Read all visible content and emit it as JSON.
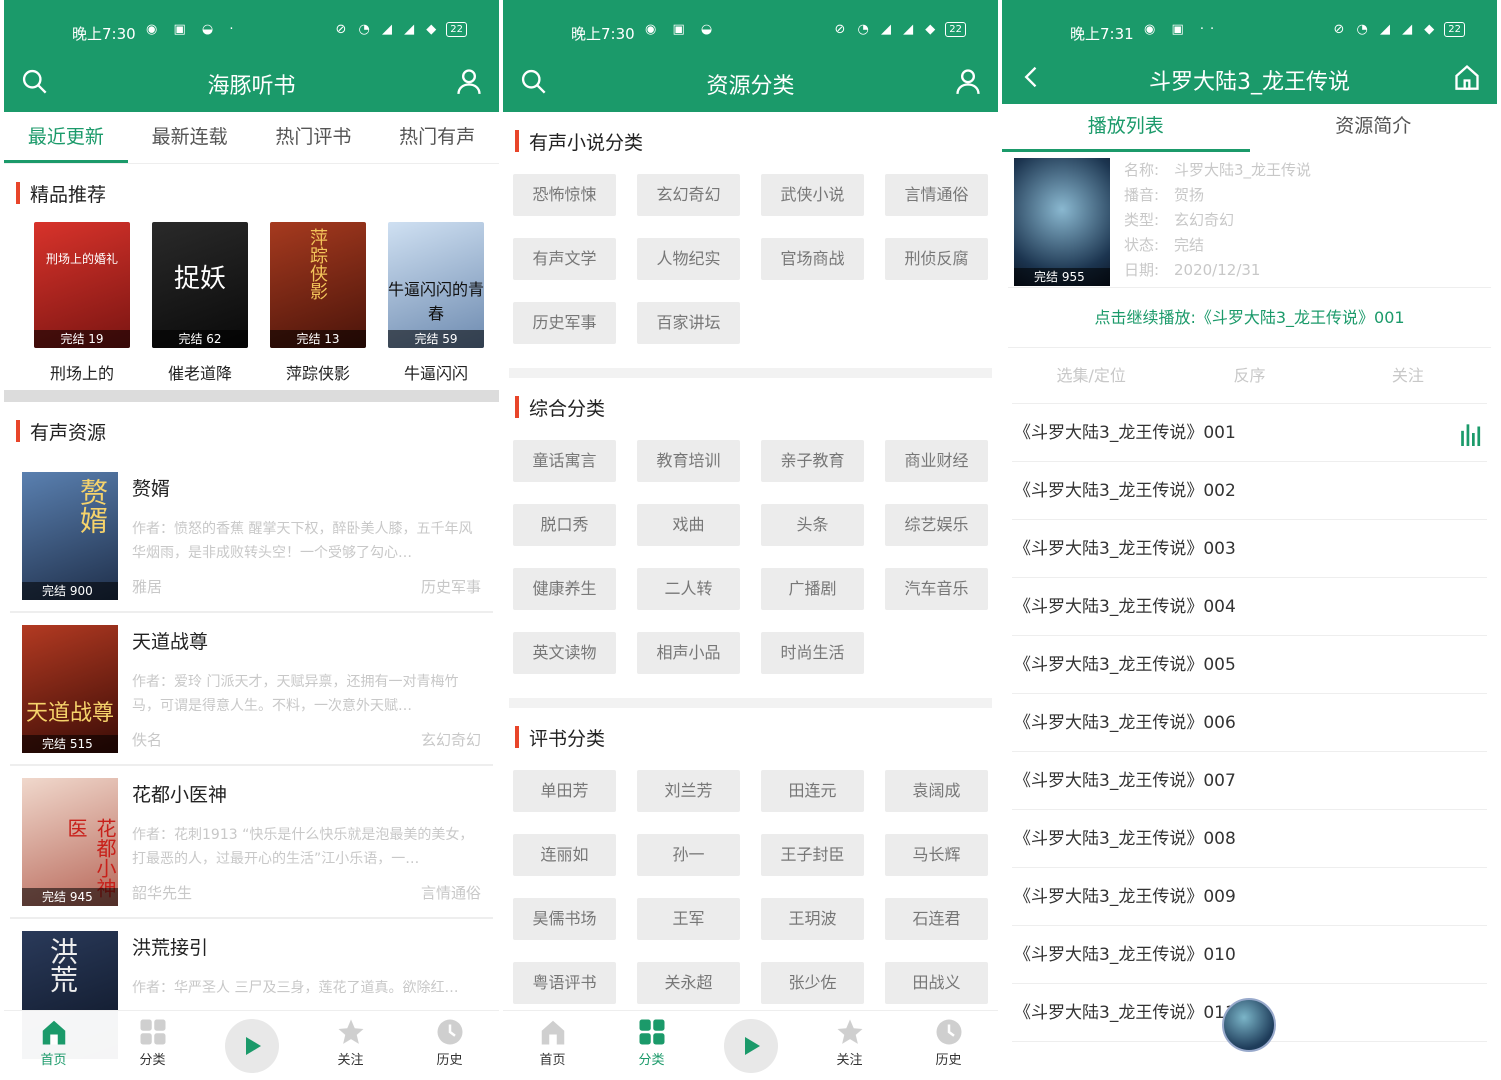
{
  "colors": {
    "brand": "#1b9a6a",
    "accent_bar": "#e8452a",
    "muted": "#c8c8c8"
  },
  "panel1": {
    "status": {
      "time": "晚上7:30",
      "battery": "22"
    },
    "title": "海豚听书",
    "tabs": [
      "最近更新",
      "最新连载",
      "热门评书",
      "热门有声"
    ],
    "rec_title": "精品推荐",
    "recommended": [
      {
        "name": "刑场上的",
        "badge": "完结 19",
        "cover_text": "刑场上的婚礼",
        "color": "#b3232a"
      },
      {
        "name": "催老道降",
        "badge": "完结 62",
        "cover_text": "捉妖",
        "color": "#1a1a1a"
      },
      {
        "name": "萍踪侠影",
        "badge": "完结 13",
        "cover_text": "萍踪侠影",
        "color": "#8a2a1a"
      },
      {
        "name": "牛逼闪闪",
        "badge": "完结 59",
        "cover_text": "牛逼闪闪的青春",
        "color": "#6e8bb0"
      }
    ],
    "res_title": "有声资源",
    "resources": [
      {
        "title": "赘婿",
        "desc": "作者：愤怒的香蕉 醒掌天下权，醉卧美人膝，五千年风华烟雨，是非成败转头空！一个受够了勾心…",
        "narrator": "雅居",
        "category": "历史军事",
        "badge": "完结 900",
        "cover_text": "赘婿",
        "color": "#3a5d8a"
      },
      {
        "title": "天道战尊",
        "desc": "作者：爱玲 门派天才，天赋异禀，还拥有一对青梅竹马，可谓是得意人生。不料，一次意外天赋…",
        "narrator": "佚名",
        "category": "玄幻奇幻",
        "badge": "完结 515",
        "cover_text": "天道战尊",
        "color": "#7a1a12"
      },
      {
        "title": "花都小医神",
        "desc": "作者：花刺1913 “快乐是什么快乐就是泡最美的美女，打最恶的人，过最开心的生活”江小乐语，一…",
        "narrator": "韶华先生",
        "category": "言情通俗",
        "badge": "完结 945",
        "cover_text": "花都小神医",
        "color": "#c77a6a"
      },
      {
        "title": "洪荒接引",
        "desc": "作者：华严圣人 三尸及三身，莲花了道真。欲除红…",
        "narrator": "",
        "category": "",
        "badge": "",
        "cover_text": "洪荒",
        "color": "#1a2a44"
      }
    ],
    "bottom_nav": [
      "首页",
      "分类",
      "",
      "关注",
      "历史"
    ]
  },
  "panel2": {
    "status": {
      "time": "晚上7:30",
      "battery": "22"
    },
    "title": "资源分类",
    "sections": [
      {
        "title": "有声小说分类",
        "items": [
          "恐怖惊悚",
          "玄幻奇幻",
          "武侠小说",
          "言情通俗",
          "有声文学",
          "人物纪实",
          "官场商战",
          "刑侦反腐",
          "历史军事",
          "百家讲坛"
        ]
      },
      {
        "title": "综合分类",
        "items": [
          "童话寓言",
          "教育培训",
          "亲子教育",
          "商业财经",
          "脱口秀",
          "戏曲",
          "头条",
          "综艺娱乐",
          "健康养生",
          "二人转",
          "广播剧",
          "汽车音乐",
          "英文读物",
          "相声小品",
          "时尚生活"
        ]
      },
      {
        "title": "评书分类",
        "items": [
          "单田芳",
          "刘兰芳",
          "田连元",
          "袁阔成",
          "连丽如",
          "孙一",
          "王子封臣",
          "马长辉",
          "昊儒书场",
          "王军",
          "王玥波",
          "石连君",
          "粤语评书",
          "关永超",
          "张少佐",
          "田战义"
        ]
      }
    ],
    "bottom_nav": [
      "首页",
      "分类",
      "",
      "关注",
      "历史"
    ]
  },
  "panel3": {
    "status": {
      "time": "晚上7:31",
      "battery": "22"
    },
    "title": "斗罗大陆3_龙王传说",
    "tabs": [
      "播放列表",
      "资源简介"
    ],
    "cover_badge": "完结 955",
    "info": [
      {
        "k": "名称:",
        "v": "斗罗大陆3_龙王传说"
      },
      {
        "k": "播音:",
        "v": "贺扬"
      },
      {
        "k": "类型:",
        "v": "玄幻奇幻"
      },
      {
        "k": "状态:",
        "v": "完结"
      },
      {
        "k": "日期:",
        "v": "2020/12/31"
      }
    ],
    "continue": "点击继续播放:《斗罗大陆3_龙王传说》001",
    "ops": [
      "选集/定位",
      "反序",
      "关注"
    ],
    "episodes": [
      "《斗罗大陆3_龙王传说》001",
      "《斗罗大陆3_龙王传说》002",
      "《斗罗大陆3_龙王传说》003",
      "《斗罗大陆3_龙王传说》004",
      "《斗罗大陆3_龙王传说》005",
      "《斗罗大陆3_龙王传说》006",
      "《斗罗大陆3_龙王传说》007",
      "《斗罗大陆3_龙王传说》008",
      "《斗罗大陆3_龙王传说》009",
      "《斗罗大陆3_龙王传说》010",
      "《斗罗大陆3_龙王传说》011"
    ]
  }
}
